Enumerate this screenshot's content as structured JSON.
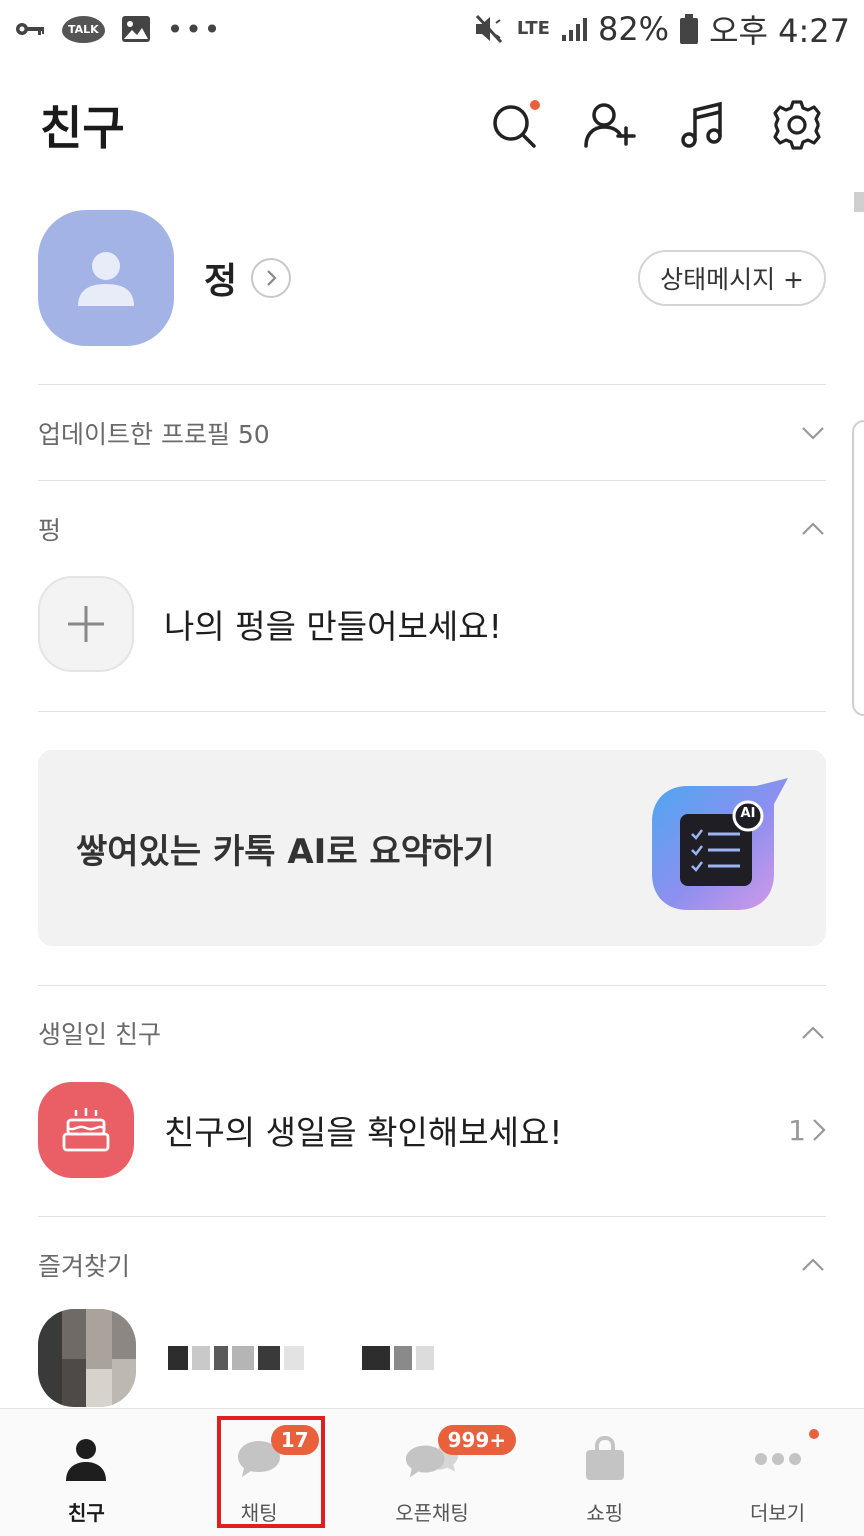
{
  "status_bar": {
    "battery": "82%",
    "time": "오후 4:27",
    "network": "LTE",
    "talk_badge": "TALK"
  },
  "header": {
    "title": "친구"
  },
  "profile": {
    "name": "정",
    "status_button": "상태메시지 +"
  },
  "sections": {
    "updated_profiles": "업데이트한 프로필 50",
    "pung": "펑",
    "pung_item": "나의 펑을 만들어보세요!",
    "ai_card": "쌓여있는 카톡 AI로 요약하기",
    "ai_badge": "AI",
    "birthday": "생일인 친구",
    "birthday_item": "친구의 생일을 확인해보세요!",
    "birthday_count": "1",
    "favorites": "즐겨찾기"
  },
  "bottom_nav": [
    {
      "label": "친구"
    },
    {
      "label": "채팅",
      "badge": "17"
    },
    {
      "label": "오픈채팅",
      "badge": "999+"
    },
    {
      "label": "쇼핑"
    },
    {
      "label": "더보기"
    }
  ],
  "colors": {
    "accent_red": "#e8603c",
    "avatar_blue": "#a3b3e6",
    "birthday_red": "#ea5f66",
    "highlight": "#e0201f"
  }
}
